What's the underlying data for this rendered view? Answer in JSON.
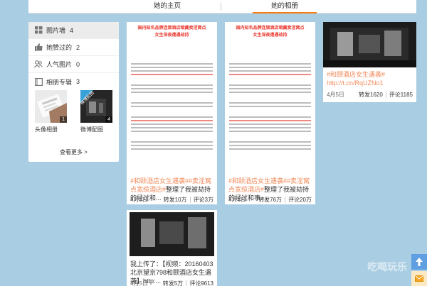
{
  "tabs": {
    "home": "她的主页",
    "album": "她的相册"
  },
  "sidebar": {
    "items": [
      {
        "label": "图片墙",
        "count": "4"
      },
      {
        "label": "她赞过的",
        "count": "2"
      },
      {
        "label": "人气图片",
        "count": "0"
      },
      {
        "label": "相册专辑",
        "count": "3"
      }
    ],
    "albums": [
      {
        "label": "头像相册",
        "count": "1"
      },
      {
        "label": "微博配图",
        "count": "4",
        "badge": "微博配图"
      }
    ],
    "see_more": "查看更多 >"
  },
  "cards": [
    {
      "doc_title_1": "国内知名品牌连锁酒店暗藏卖淫窝点",
      "doc_title_2": "女生深夜遭遇劫持",
      "caption_hl": "#和颐酒店女生遇袭##卖淫窝点宽缆酒店#",
      "caption_rest": "整理了我被劫持的经过和...",
      "date": "4月5日",
      "reposts": "转发10万",
      "comments": "评论3万"
    },
    {
      "doc_title_1": "国内知名品牌连锁酒店暗藏卖淫窝点",
      "doc_title_2": "女生深夜遭遇劫持",
      "caption_hl": "#和颐酒店女生遇袭##卖淫窝点宽缆酒店#",
      "caption_rest": "整理了我被劫持的经过和事...",
      "date": "4月5日",
      "reposts": "转发76万",
      "comments": "评论20万"
    },
    {
      "caption_hl": "#和颐酒店女生遇袭# http://t.cn/RqUZNo1",
      "date": "4月5日",
      "reposts": "转发1620",
      "comments": "评论1185"
    },
    {
      "caption_plain": "我上传了：【视频：20160403北京望京798和颐酒店女生遇袭】http:...",
      "date": "4月5日",
      "reposts": "转发5万",
      "comments": "评论9613"
    }
  ],
  "watermark": "吃喝玩乐"
}
